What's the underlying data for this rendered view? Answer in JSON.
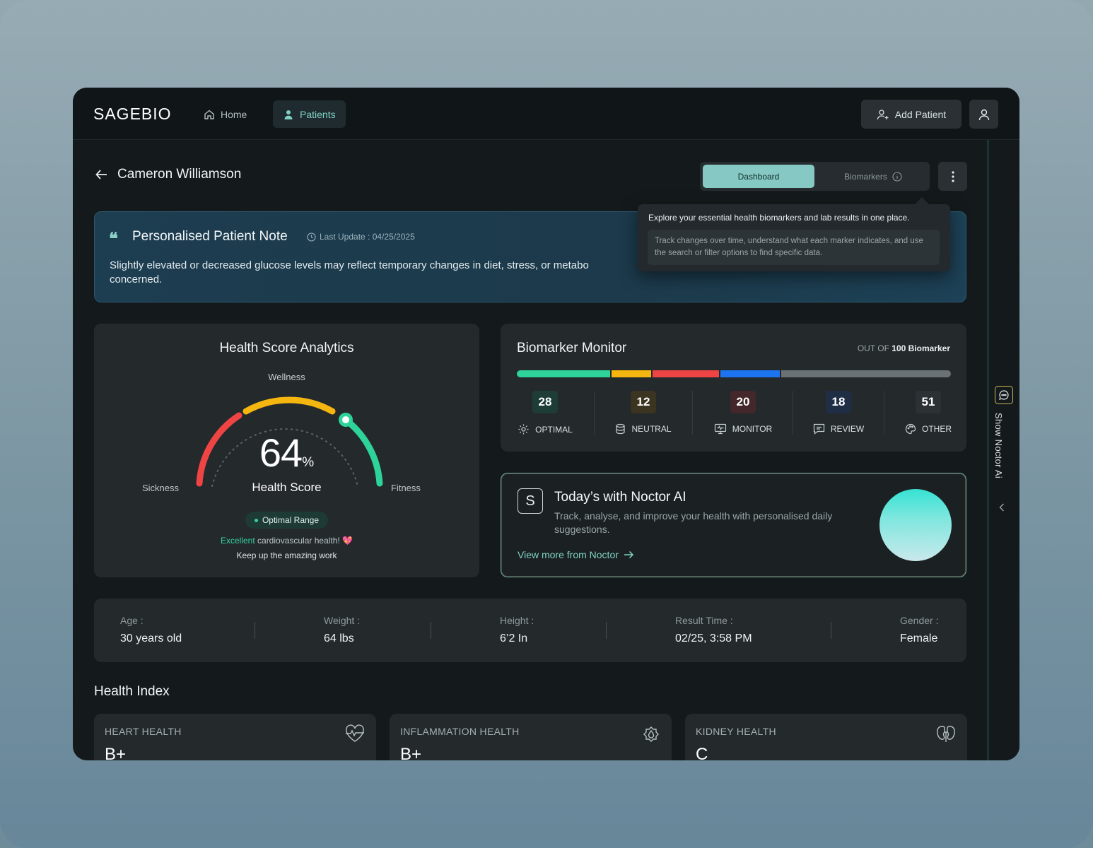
{
  "app": {
    "logo": "SAGEBIO"
  },
  "nav": {
    "home": "Home",
    "patients": "Patients",
    "add_patient": "Add Patient"
  },
  "patient": {
    "name": "Cameron Williamson"
  },
  "tabs": {
    "dashboard": "Dashboard",
    "biomarkers": "Biomarkers"
  },
  "tooltip": {
    "title": "Explore your essential health biomarkers and lab results in one place.",
    "body": "Track changes over time, understand what each marker indicates, and use the search or filter options to find specific data."
  },
  "note": {
    "title": "Personalised Patient Note",
    "last_update": "Last Update : 04/25/2025",
    "body": "Slightly elevated or decreased glucose levels may reflect temporary changes in diet, stress, or metabo",
    "body_end": "concerned."
  },
  "health_score": {
    "title": "Health Score Analytics",
    "wellness": "Wellness",
    "sickness": "Sickness",
    "fitness": "Fitness",
    "value": "64",
    "unit": "%",
    "label": "Health Score",
    "range": "Optimal Range",
    "msg_highlight": "Excellent",
    "msg_rest": "cardiovascular health! 💖",
    "msg2": "Keep up the amazing work",
    "score_fraction": 0.64
  },
  "biomarker_monitor": {
    "title": "Biomarker Monitor",
    "out_of_prefix": "OUT OF",
    "out_of_value": "100 Biomarker",
    "stats": [
      {
        "count": "28",
        "label": "OPTIMAL",
        "color": "#2ed39a",
        "badge": "#1e3d36"
      },
      {
        "count": "12",
        "label": "NEUTRAL",
        "color": "#f5b70f",
        "badge": "#3a3420"
      },
      {
        "count": "20",
        "label": "MONITOR",
        "color": "#ef4444",
        "badge": "#44272a"
      },
      {
        "count": "18",
        "label": "REVIEW",
        "color": "#1d74f0",
        "badge": "#1f2d45"
      },
      {
        "count": "51",
        "label": "OTHER",
        "color": "#6b7276",
        "badge": "#2b3134"
      }
    ]
  },
  "noctor": {
    "title": "Today’s with Noctor AI",
    "desc": "Track, analyse, and improve your health with personalised daily suggestions.",
    "link": "View more from Noctor",
    "icon_letter": "S"
  },
  "side_panel": {
    "label": "Show Noctor Ai"
  },
  "info": {
    "age_k": "Age :",
    "age_v": "30 years old",
    "weight_k": "Weight :",
    "weight_v": "64 lbs",
    "height_k": "Height :",
    "height_v": "6’2 In",
    "result_k": "Result Time :",
    "result_v": "02/25, 3:58 PM",
    "gender_k": "Gender :",
    "gender_v": "Female"
  },
  "health_index": {
    "title": "Health Index",
    "cards": [
      {
        "name": "HEART HEALTH",
        "grade": "B+",
        "icon": "heart-pulse-icon"
      },
      {
        "name": "INFLAMMATION HEALTH",
        "grade": "B+",
        "icon": "drop-badge-icon"
      },
      {
        "name": "KIDNEY HEALTH",
        "grade": "C",
        "icon": "kidney-icon"
      }
    ]
  }
}
